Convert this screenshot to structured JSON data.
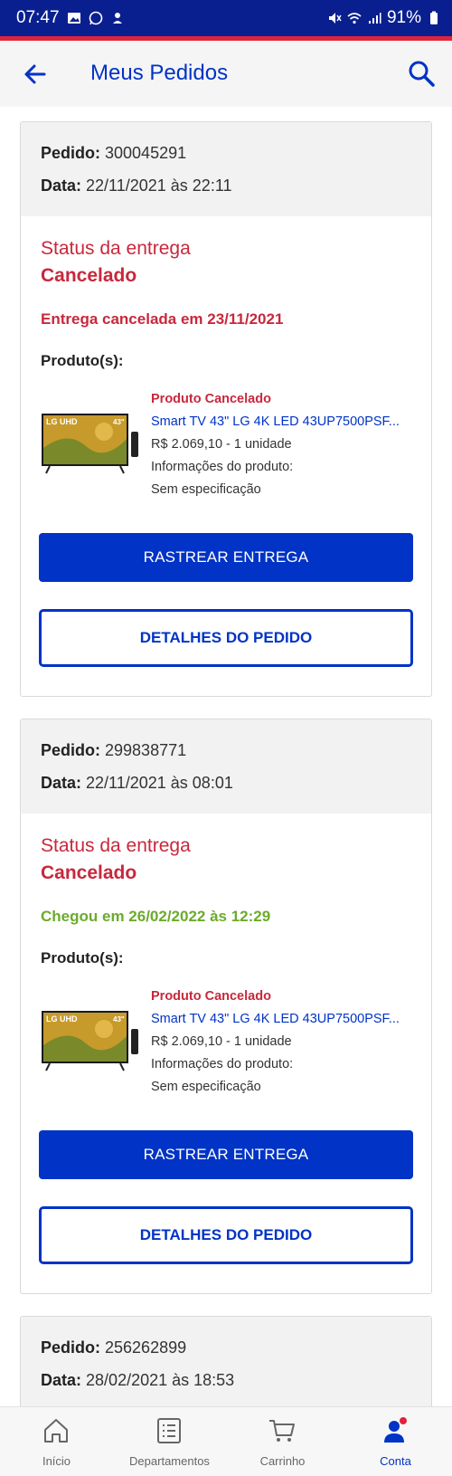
{
  "status_bar": {
    "time": "07:47",
    "battery": "91%"
  },
  "app_bar": {
    "title": "Meus Pedidos"
  },
  "orders": [
    {
      "pedido_label": "Pedido:",
      "pedido_number": "300045291",
      "data_label": "Data:",
      "data_value": "22/11/2021 às 22:11",
      "status_label": "Status da entrega",
      "status_value": "Cancelado",
      "status_message": "Entrega cancelada em 23/11/2021",
      "status_message_color": "#c8283c",
      "products_label": "Produto(s):",
      "product": {
        "state": "Produto Cancelado",
        "name": "Smart TV 43\" LG 4K LED 43UP7500PSF...",
        "price_qty": "R$ 2.069,10 - 1 unidade",
        "info_label": "Informações do produto:",
        "info_value": "Sem especificação",
        "image_text": "LG UHD"
      },
      "track_button": "RASTREAR ENTREGA",
      "details_button": "DETALHES DO PEDIDO"
    },
    {
      "pedido_label": "Pedido:",
      "pedido_number": "299838771",
      "data_label": "Data:",
      "data_value": "22/11/2021 às 08:01",
      "status_label": "Status da entrega",
      "status_value": "Cancelado",
      "status_message": "Chegou em 26/02/2022 às 12:29",
      "status_message_color": "#6bab2b",
      "products_label": "Produto(s):",
      "product": {
        "state": "Produto Cancelado",
        "name": "Smart TV 43\" LG 4K LED 43UP7500PSF...",
        "price_qty": "R$ 2.069,10 - 1 unidade",
        "info_label": "Informações do produto:",
        "info_value": "Sem especificação",
        "image_text": "LG UHD"
      },
      "track_button": "RASTREAR ENTREGA",
      "details_button": "DETALHES DO PEDIDO"
    },
    {
      "pedido_label": "Pedido:",
      "pedido_number": "256262899",
      "data_label": "Data:",
      "data_value": "28/02/2021 às 18:53"
    }
  ],
  "bottom_nav": [
    {
      "label": "Início",
      "icon": "home-icon",
      "active": false
    },
    {
      "label": "Departamentos",
      "icon": "list-icon",
      "active": false
    },
    {
      "label": "Carrinho",
      "icon": "cart-icon",
      "active": false
    },
    {
      "label": "Conta",
      "icon": "user-icon",
      "active": true
    }
  ],
  "colors": {
    "brand_blue": "#0033c6",
    "status_red": "#c8283c",
    "status_green": "#6bab2b",
    "status_bar": "#0a1f8f"
  }
}
